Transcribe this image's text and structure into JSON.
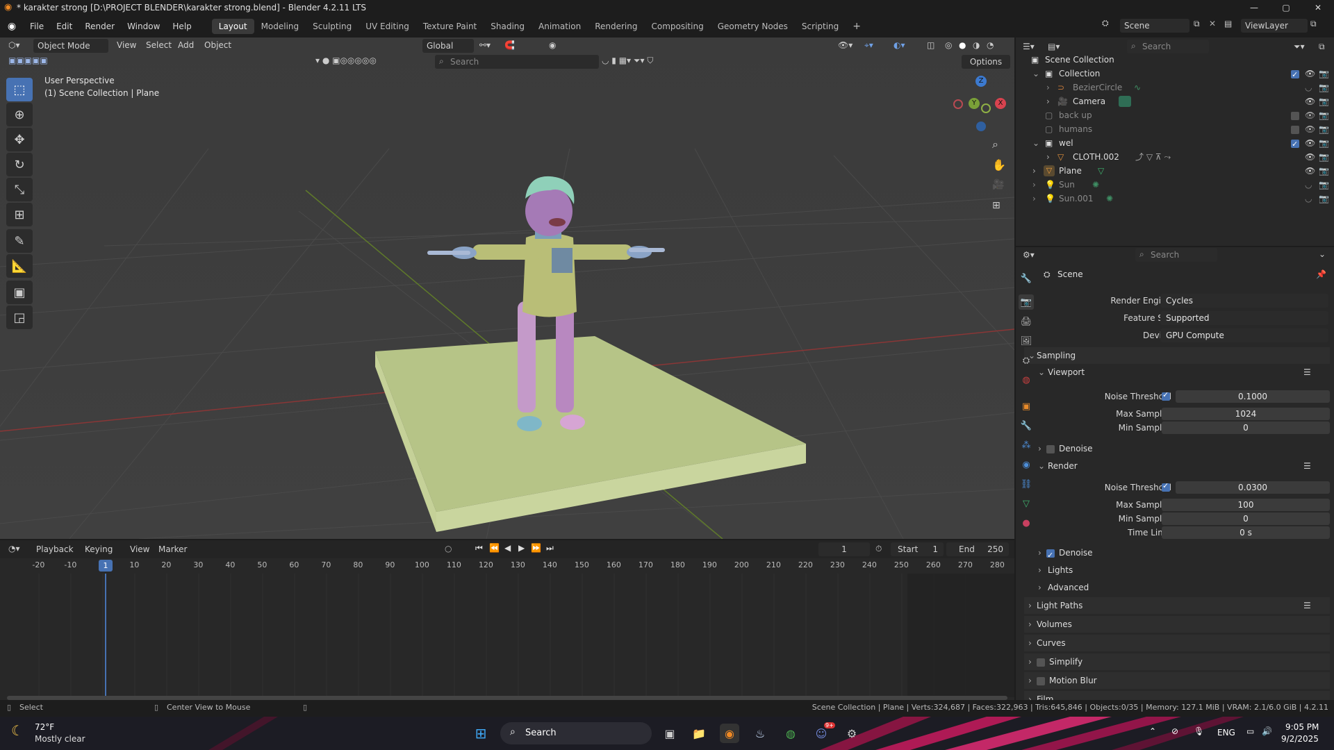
{
  "window": {
    "title": "* karakter strong [D:\\PROJECT BLENDER\\karakter strong.blend] - Blender 4.2.11 LTS",
    "minimize": "—",
    "maximize": "▢",
    "close": "✕"
  },
  "menu": [
    "File",
    "Edit",
    "Render",
    "Window",
    "Help"
  ],
  "workspaces": [
    "Layout",
    "Modeling",
    "Sculpting",
    "UV Editing",
    "Texture Paint",
    "Shading",
    "Animation",
    "Rendering",
    "Compositing",
    "Geometry Nodes",
    "Scripting"
  ],
  "active_workspace": "Layout",
  "scene_field": "Scene",
  "viewlayer_field": "ViewLayer",
  "viewport": {
    "mode": "Object Mode",
    "menus": [
      "View",
      "Select",
      "Add",
      "Object"
    ],
    "orientation": "Global",
    "search_placeholder": "Search",
    "options": "Options",
    "overlay_line1": "User Perspective",
    "overlay_line2": "(1) Scene Collection | Plane",
    "gizmo": {
      "z": "Z",
      "y": "Y",
      "x": "X"
    }
  },
  "outliner": {
    "search_placeholder": "Search",
    "rows": [
      {
        "name": "Scene Collection",
        "indent": 0,
        "dim": false
      },
      {
        "name": "Collection",
        "indent": 1,
        "dim": false
      },
      {
        "name": "BezierCircle",
        "indent": 2,
        "dim": true
      },
      {
        "name": "Camera",
        "indent": 2,
        "dim": false
      },
      {
        "name": "back up",
        "indent": 1,
        "dim": true
      },
      {
        "name": "humans",
        "indent": 1,
        "dim": true
      },
      {
        "name": "wel",
        "indent": 1,
        "dim": false
      },
      {
        "name": "CLOTH.002",
        "indent": 2,
        "dim": false
      },
      {
        "name": "Plane",
        "indent": 1,
        "dim": false
      },
      {
        "name": "Sun",
        "indent": 1,
        "dim": true
      },
      {
        "name": "Sun.001",
        "indent": 1,
        "dim": true
      }
    ]
  },
  "properties": {
    "search_placeholder": "Search",
    "context": "Scene",
    "render_engine_label": "Render Engine",
    "render_engine": "Cycles",
    "feature_set_label": "Feature Set",
    "feature_set": "Supported",
    "device_label": "Device",
    "device": "GPU Compute",
    "sampling": "Sampling",
    "viewport": "Viewport",
    "noise_threshold_label": "Noise Threshold",
    "vp_noise": "0.1000",
    "max_samples_label": "Max Samples",
    "vp_max": "1024",
    "min_samples_label": "Min Samples",
    "vp_min": "0",
    "denoise": "Denoise",
    "render": "Render",
    "r_noise": "0.0300",
    "r_max": "100",
    "r_min": "0",
    "time_limit_label": "Time Limit",
    "r_time": "0 s",
    "denoise2": "Denoise",
    "lights": "Lights",
    "advanced": "Advanced",
    "light_paths": "Light Paths",
    "volumes": "Volumes",
    "curves": "Curves",
    "simplify": "Simplify",
    "motion_blur": "Motion Blur",
    "film": "Film"
  },
  "timeline": {
    "menus": [
      "Playback",
      "Keying",
      "View",
      "Marker"
    ],
    "current_frame": "1",
    "start_label": "Start",
    "start": "1",
    "end_label": "End",
    "end": "250",
    "ruler": [
      "-20",
      "-10",
      "1",
      "10",
      "20",
      "30",
      "40",
      "50",
      "60",
      "70",
      "80",
      "90",
      "100",
      "110",
      "120",
      "130",
      "140",
      "150",
      "160",
      "170",
      "180",
      "190",
      "200",
      "210",
      "220",
      "230",
      "240",
      "250",
      "260",
      "270",
      "280"
    ],
    "marker_frame": "1"
  },
  "status": {
    "left1": "Select",
    "left2": "Center View to Mouse",
    "right": "Scene Collection | Plane | Verts:324,687 | Faces:322,963 | Tris:645,846 | Objects:0/35 | Memory: 127.1 MiB | VRAM: 2.1/6.0 GiB | 4.2.11"
  },
  "taskbar": {
    "weather_temp": "72°F",
    "weather_desc": "Mostly clear",
    "search": "Search",
    "lang": "ENG",
    "time": "9:05 PM",
    "date": "9/2/2025",
    "discord_badge": "9+"
  },
  "colors": {
    "accent": "#4772b3",
    "viewport_bg": "#3d3d3d",
    "panel_bg": "#282828",
    "floor": "#b6c487",
    "skin": "#a57ab6",
    "shirt": "#b9be77",
    "pants": "#c49ac9"
  }
}
